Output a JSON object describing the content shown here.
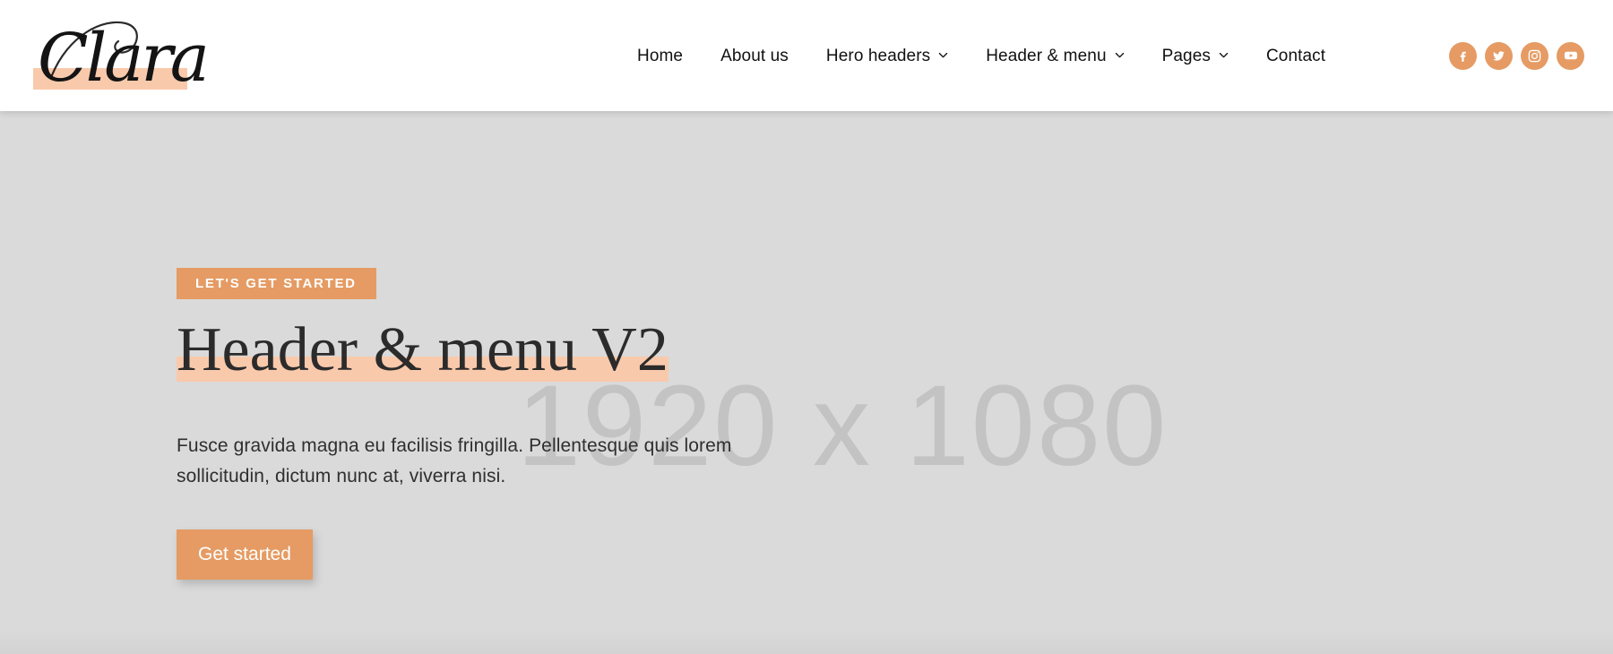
{
  "colors": {
    "accent": "#e59b63",
    "highlight": "#f9c9ab",
    "hero_bg": "#dadada",
    "header_bg": "#ffffff",
    "text_dark": "#111111",
    "placeholder_gray": "#c3c3c3"
  },
  "header": {
    "logo": {
      "text": "Clara",
      "icon": "script-wordmark"
    },
    "nav": [
      {
        "label": "Home",
        "has_dropdown": false
      },
      {
        "label": "About us",
        "has_dropdown": false
      },
      {
        "label": "Hero headers",
        "has_dropdown": true
      },
      {
        "label": "Header & menu",
        "has_dropdown": true
      },
      {
        "label": "Pages",
        "has_dropdown": true
      },
      {
        "label": "Contact",
        "has_dropdown": false
      }
    ],
    "social": [
      {
        "name": "facebook",
        "label": "Facebook"
      },
      {
        "name": "twitter",
        "label": "Twitter"
      },
      {
        "name": "instagram",
        "label": "Instagram"
      },
      {
        "name": "youtube",
        "label": "YouTube"
      }
    ]
  },
  "hero": {
    "eyebrow": "LET'S GET STARTED",
    "title": "Header & menu V2",
    "paragraph": "Fusce gravida magna eu facilisis fringilla. Pellentesque quis lorem sollicitudin, dictum nunc at, viverra nisi.",
    "cta_label": "Get started",
    "placeholder_text": "1920 x 1080"
  }
}
